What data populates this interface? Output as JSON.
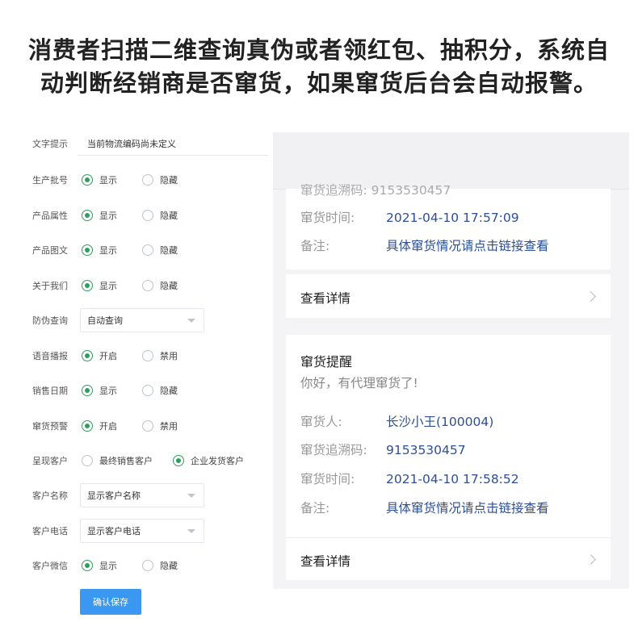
{
  "headline": {
    "line1": "消费者扫描二维查询真伪或者领红包、抽积分，系统自",
    "line2": "动判断经销商是否窜货，如果窜货后台会自动报警。"
  },
  "form": {
    "text_prompt": {
      "label": "文字提示",
      "value": "当前物流编码尚未定义"
    },
    "rows": [
      {
        "label": "生产批号",
        "a": "显示",
        "b": "隐藏",
        "selected": "a"
      },
      {
        "label": "产品属性",
        "a": "显示",
        "b": "隐藏",
        "selected": "a"
      },
      {
        "label": "产品图文",
        "a": "显示",
        "b": "隐藏",
        "selected": "a"
      },
      {
        "label": "关于我们",
        "a": "显示",
        "b": "隐藏",
        "selected": "a"
      },
      {
        "label": "防伪查询",
        "select": "自动查询"
      },
      {
        "label": "语音播报",
        "a": "开启",
        "b": "禁用",
        "selected": "a"
      },
      {
        "label": "销售日期",
        "a": "显示",
        "b": "隐藏",
        "selected": "a"
      },
      {
        "label": "窜货预警",
        "a": "开启",
        "b": "禁用",
        "selected": "a"
      },
      {
        "label": "呈现客户",
        "a": "最终销售客户",
        "b": "企业发货客户",
        "selected": "b"
      },
      {
        "label": "客户名称",
        "select": "显示客户名称"
      },
      {
        "label": "客户电话",
        "select": "显示客户电话"
      },
      {
        "label": "客户微信",
        "a": "显示",
        "b": "隐藏",
        "selected": "a"
      }
    ],
    "save_label": "确认保存"
  },
  "panel": {
    "card_a": {
      "cut_line": "窜货追溯码: 9153530457",
      "time_label": "窜货时间:",
      "time_value": "2021-04-10 17:57:09",
      "note_label": "备注:",
      "note_value": "具体窜货情况请点击链接查看",
      "detail_label": "查看详情"
    },
    "card_b": {
      "title": "窜货提醒",
      "subtitle": "你好，有代理窜货了!",
      "person_label": "窜货人:",
      "person_value": "长沙小王(100004)",
      "trace_label": "窜货追溯码:",
      "trace_value": "9153530457",
      "time_label": "窜货时间:",
      "time_value": "2021-04-10 17:58:52",
      "note_label": "备注:",
      "note_value": "具体窜货情况请点击链接查看",
      "detail_label": "查看详情"
    }
  },
  "colors": {
    "accent_green": "#2e9e5c",
    "button_blue": "#3a98f0",
    "link_blue": "#2e4f96"
  }
}
